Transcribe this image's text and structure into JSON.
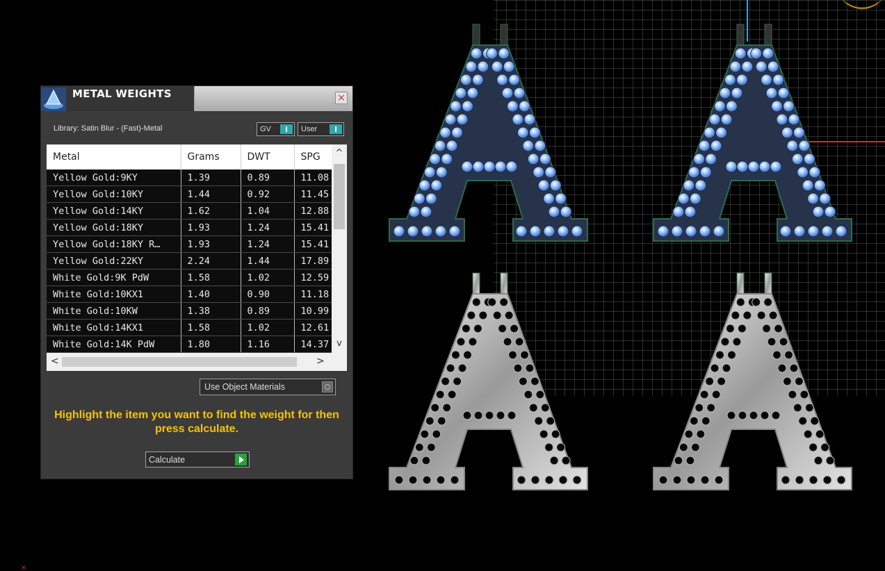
{
  "panel": {
    "title": "METAL WEIGHTS",
    "close_label": "×",
    "library": "Library: Satin Blur - (Fast)-Metal",
    "toggle_gv_label": "GV",
    "toggle_user_label": "User",
    "columns": [
      "Metal",
      "Grams",
      "DWT",
      "SPG"
    ],
    "rows": [
      [
        "Yellow Gold:9KY",
        "1.39",
        "0.89",
        "11.08"
      ],
      [
        "Yellow Gold:10KY",
        "1.44",
        "0.92",
        "11.45"
      ],
      [
        "Yellow Gold:14KY",
        "1.62",
        "1.04",
        "12.88"
      ],
      [
        "Yellow Gold:18KY",
        "1.93",
        "1.24",
        "15.41"
      ],
      [
        "Yellow Gold:18KY R…",
        "1.93",
        "1.24",
        "15.41"
      ],
      [
        "Yellow Gold:22KY",
        "2.24",
        "1.44",
        "17.89"
      ],
      [
        "White Gold:9K PdW",
        "1.58",
        "1.02",
        "12.59"
      ],
      [
        "White Gold:10KX1",
        "1.40",
        "0.90",
        "11.18"
      ],
      [
        "White Gold:10KW",
        "1.38",
        "0.89",
        "10.99"
      ],
      [
        "White Gold:14KX1",
        "1.58",
        "1.02",
        "12.61"
      ],
      [
        "White Gold:14K PdW",
        "1.80",
        "1.16",
        "14.37"
      ]
    ],
    "use_object_materials_label": "Use Object Materials",
    "hint": "Highlight the item you want to find the weight for then press calculate.",
    "calculate_label": "Calculate"
  },
  "colors": {
    "hint": "#f6c400",
    "accent_teal": "#32a7a7",
    "go_green": "#27a33b",
    "diamond_blue": "#7eb2ff",
    "metal_silver": "#c8c8c8",
    "outline_green": "#2d6b4a"
  },
  "viewport": {
    "letter": "A",
    "models": [
      {
        "style": "diamond"
      },
      {
        "style": "diamond"
      },
      {
        "style": "metal"
      },
      {
        "style": "metal"
      }
    ]
  }
}
